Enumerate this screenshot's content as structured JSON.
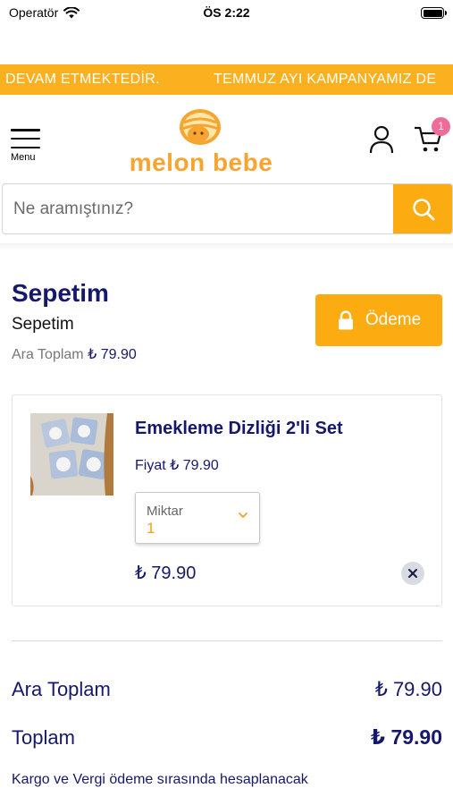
{
  "status_bar": {
    "carrier": "Operatör",
    "time": "ÖS 2:22"
  },
  "announcement": {
    "text_left": "DEVAM ETMEKTEDİR.",
    "text_right": "TEMMUZ AYI KAMPANYAMIZ DE"
  },
  "header": {
    "menu_label": "Menu",
    "logo_text": "melon bebe",
    "cart_count": "1"
  },
  "search": {
    "placeholder": "Ne aramıştınız?"
  },
  "cart": {
    "title": "Sepetim",
    "subtitle": "Sepetim",
    "subtotal_label": "Ara Toplam",
    "subtotal_value": "₺ 79.90",
    "checkout_label": "Ödeme"
  },
  "items": [
    {
      "name": "Emekleme Dizliği 2'li Set",
      "price_label": "Fiyat",
      "price": "₺ 79.90",
      "quantity_label": "Miktar",
      "quantity": "1",
      "line_total": "₺ 79.90"
    }
  ],
  "summary": {
    "subtotal_label": "Ara Toplam",
    "subtotal_value": "₺ 79.90",
    "total_label": "Toplam",
    "total_value": "₺ 79.90",
    "note": "Kargo ve Vergi ödeme sırasında hesaplanacak"
  },
  "colors": {
    "accent": "#fcab10",
    "navy": "#16186b",
    "badge": "#f06b97"
  }
}
